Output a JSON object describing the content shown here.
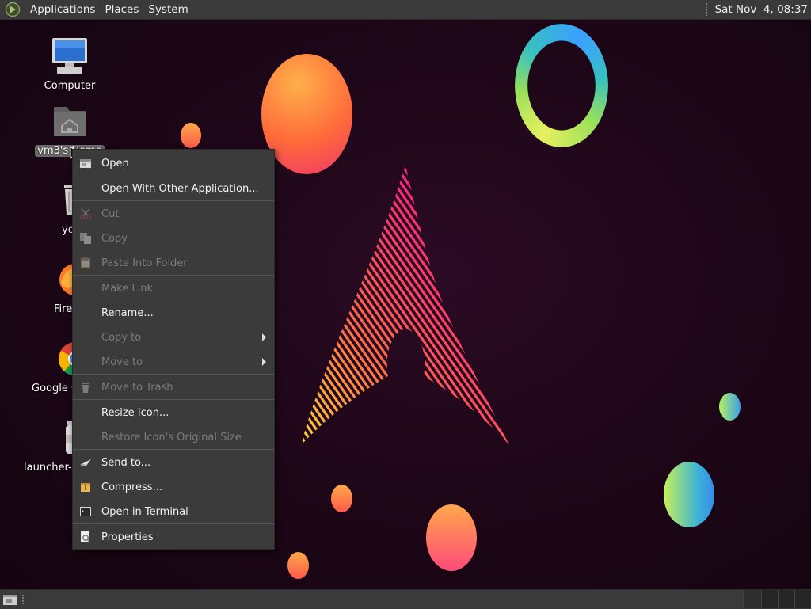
{
  "top_panel": {
    "menus": [
      "Applications",
      "Places",
      "System"
    ],
    "clock": "Sat Nov  4, 08:37"
  },
  "desktop_icons": [
    {
      "label": "Computer",
      "icon": "computer-icon"
    },
    {
      "label": "vm3's Home",
      "icon": "home-folder-icon",
      "selected": true
    },
    {
      "label": "yo",
      "icon": "trash-icon"
    },
    {
      "label": "Fire",
      "icon": "firefox-icon"
    },
    {
      "label": "Google C",
      "icon": "chrome-icon"
    },
    {
      "label": "launcher-1",
      "icon": "launcher-icon"
    }
  ],
  "context_menu": {
    "items": [
      {
        "label": "Open",
        "icon": "open-icon",
        "enabled": true
      },
      {
        "label": "Open With Other Application...",
        "enabled": true
      },
      {
        "label": "Cut",
        "icon": "scissors-icon",
        "enabled": false
      },
      {
        "label": "Copy",
        "icon": "copy-icon",
        "enabled": false
      },
      {
        "label": "Paste Into Folder",
        "icon": "paste-icon",
        "enabled": false
      },
      {
        "label": "Make Link",
        "enabled": false
      },
      {
        "label": "Rename...",
        "enabled": true
      },
      {
        "label": "Copy to",
        "enabled": false,
        "submenu": true
      },
      {
        "label": "Move to",
        "enabled": false,
        "submenu": true
      },
      {
        "label": "Move to Trash",
        "icon": "trash-icon",
        "enabled": false
      },
      {
        "label": "Resize Icon...",
        "enabled": true
      },
      {
        "label": "Restore Icon's Original Size",
        "enabled": false
      },
      {
        "label": "Send to...",
        "icon": "send-icon",
        "enabled": true
      },
      {
        "label": "Compress...",
        "icon": "archive-icon",
        "enabled": true
      },
      {
        "label": "Open in Terminal",
        "icon": "terminal-icon",
        "enabled": true
      },
      {
        "label": "Properties",
        "icon": "properties-icon",
        "enabled": true
      }
    ]
  },
  "colors": {
    "panel": "#3a3a3a",
    "desktop_background": "#1e0718",
    "menu_background": "#3b3b3b",
    "menu_text": "#f2f2f2",
    "menu_text_disabled": "#7c7c7c"
  }
}
